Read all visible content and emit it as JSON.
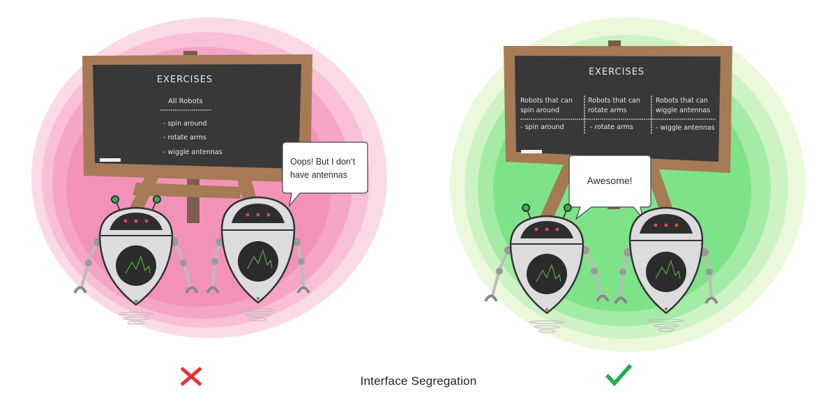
{
  "caption": "Interface Segregation",
  "colors": {
    "bad_blob": "#f07aa8",
    "good_blob": "#5fe06a",
    "wrong_mark": "#e8303a",
    "right_mark": "#1fae4e",
    "board_frame": "#a57a55",
    "board_surface": "#383838",
    "robot_eye": "#e8454f",
    "robot_antenna_tip": "#2fb34f",
    "robot_screen_line": "#5fa84a"
  },
  "left_panel": {
    "verdict_icon": "cross-icon",
    "board": {
      "title": "EXERCISES",
      "subtitle": "All Robots",
      "items": [
        "- spin around",
        "- rotate arms",
        "- wiggle antennas"
      ]
    },
    "speech_bubble": {
      "line1": "Oops! But I don’t",
      "line2": "have antennas"
    },
    "robots": [
      {
        "has_antennas": true
      },
      {
        "has_antennas": false
      }
    ]
  },
  "right_panel": {
    "verdict_icon": "check-icon",
    "board": {
      "title": "EXERCISES",
      "columns": [
        {
          "header_line1": "Robots that can",
          "header_line2": "spin around",
          "item": "- spin around"
        },
        {
          "header_line1": "Robots that can",
          "header_line2": "rotate arms",
          "item": "- rotate arms"
        },
        {
          "header_line1": "Robots that can",
          "header_line2": "wiggle antennas",
          "item": "- wiggle antennas"
        }
      ]
    },
    "speech_bubble": {
      "text": "Awesome!"
    },
    "robots": [
      {
        "has_antennas": true
      },
      {
        "has_antennas": false
      }
    ]
  }
}
